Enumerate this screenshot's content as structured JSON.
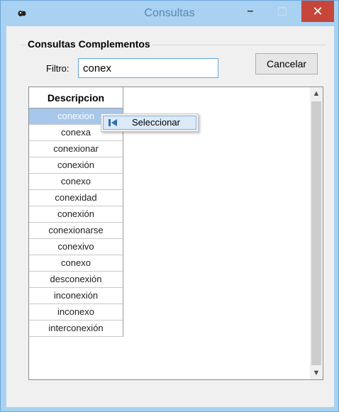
{
  "window": {
    "title": "Consultas",
    "minimize_label": "–",
    "close_label": "✕",
    "icon": "app-icon"
  },
  "group": {
    "title": "Consultas Complementos"
  },
  "filter": {
    "label": "Filtro:",
    "value": "conex"
  },
  "buttons": {
    "cancel_label": "Cancelar"
  },
  "grid": {
    "column_header": "Descripcion",
    "selected_index": 0,
    "rows": [
      "conexion",
      "conexa",
      "conexionar",
      "conexión",
      "conexo",
      "conexidad",
      "conexión",
      "conexionarse",
      "conexivo",
      "conexo",
      "desconexión",
      "inconexión",
      "inconexo",
      "interconexión"
    ]
  },
  "context_menu": {
    "items": [
      {
        "label": "Seleccionar",
        "icon": "select-first-icon"
      }
    ]
  },
  "colors": {
    "title_bar": "#a9d2f2",
    "close_button": "#c7463a",
    "selected_row": "#a7c8ec",
    "menu_highlight": "#dbe9f9"
  }
}
